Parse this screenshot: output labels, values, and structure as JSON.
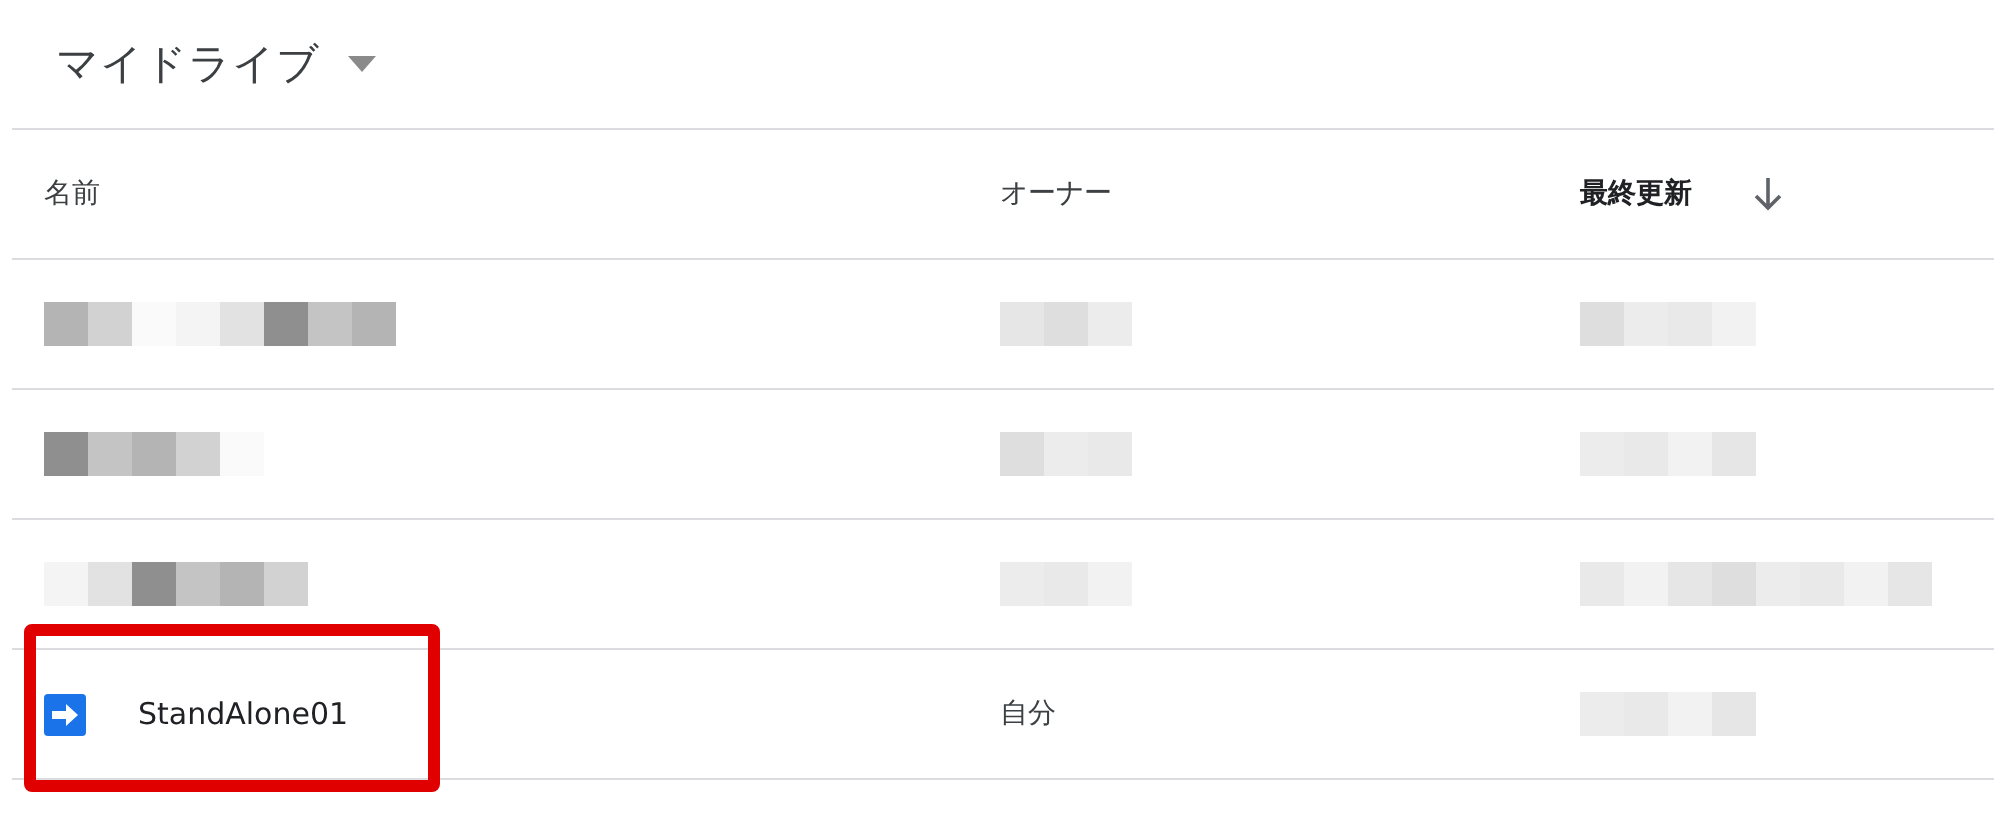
{
  "header": {
    "title": "マイドライブ"
  },
  "table": {
    "columns": [
      {
        "label": "名前",
        "sorted": false
      },
      {
        "label": "オーナー",
        "sorted": false
      },
      {
        "label": "最終更新",
        "sorted": true
      }
    ],
    "rows": [
      {
        "kind": "redacted",
        "highlighted": false
      },
      {
        "kind": "redacted",
        "highlighted": false
      },
      {
        "kind": "redacted",
        "highlighted": false
      },
      {
        "kind": "file",
        "name": "StandAlone01",
        "owner": "自分",
        "highlighted": true
      }
    ]
  }
}
